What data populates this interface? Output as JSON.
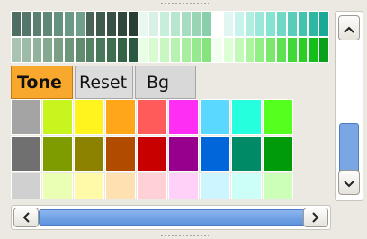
{
  "tabs": {
    "tone": "Tone",
    "reset": "Reset",
    "bg": "Bg"
  },
  "shade_rows": [
    [
      "#4f6e63",
      "#54776a",
      "#598071",
      "#5f8878",
      "#65917f",
      "#6a9a86",
      "#709f8b",
      "#496355",
      "#405a4d",
      "#385045",
      "#30473c",
      "#293f35",
      "#e8f8f0",
      "#d8f1e4",
      "#c6eed9",
      "#b6e7cc",
      "#a6ddc1",
      "#97d5b6",
      "#89cfab",
      "#ffffff",
      "#e0f6f3",
      "#c8f2ec",
      "#b1ede3",
      "#9ae8da",
      "#84e3d1",
      "#6fd9c6",
      "#59cdb9",
      "#43c2ad",
      "#2fb8a1",
      "#1aa994"
    ],
    [
      "#a9c4b1",
      "#9dbba6",
      "#91b29b",
      "#85a990",
      "#79a085",
      "#6d967a",
      "#618c6f",
      "#558265",
      "#4a785b",
      "#3f6e51",
      "#346348",
      "#2a593f",
      "#e9ffe4",
      "#d9fbd2",
      "#c8f7c1",
      "#b8f2b1",
      "#a7ee9f",
      "#96ea8e",
      "#85e57c",
      "#f2fff0",
      "#dcffd6",
      "#c4fab9",
      "#abf59f",
      "#92ef85",
      "#7ae86d",
      "#5ee153",
      "#43d839",
      "#2ccd25",
      "#14bf19",
      "#0aa11a"
    ]
  ],
  "swatch_rows": [
    [
      "#a4a4a4",
      "#c9f51e",
      "#fff41e",
      "#ffa619",
      "#ff5b5b",
      "#ff2ef4",
      "#5bd8ff",
      "#26ffdd",
      "#55ff1e",
      "#ece9e2"
    ],
    [
      "#707070",
      "#7e9b00",
      "#8c8200",
      "#b04b00",
      "#c80000",
      "#96008c",
      "#0066d9",
      "#008b66",
      "#009b0a",
      "#ece9e2"
    ],
    [
      "#d0d0d0",
      "#eaffb3",
      "#fffaa8",
      "#ffe0b0",
      "#ffd0d6",
      "#ffd0f8",
      "#ccf5ff",
      "#ccfff7",
      "#ccffb8",
      "#ece9e2"
    ]
  ]
}
